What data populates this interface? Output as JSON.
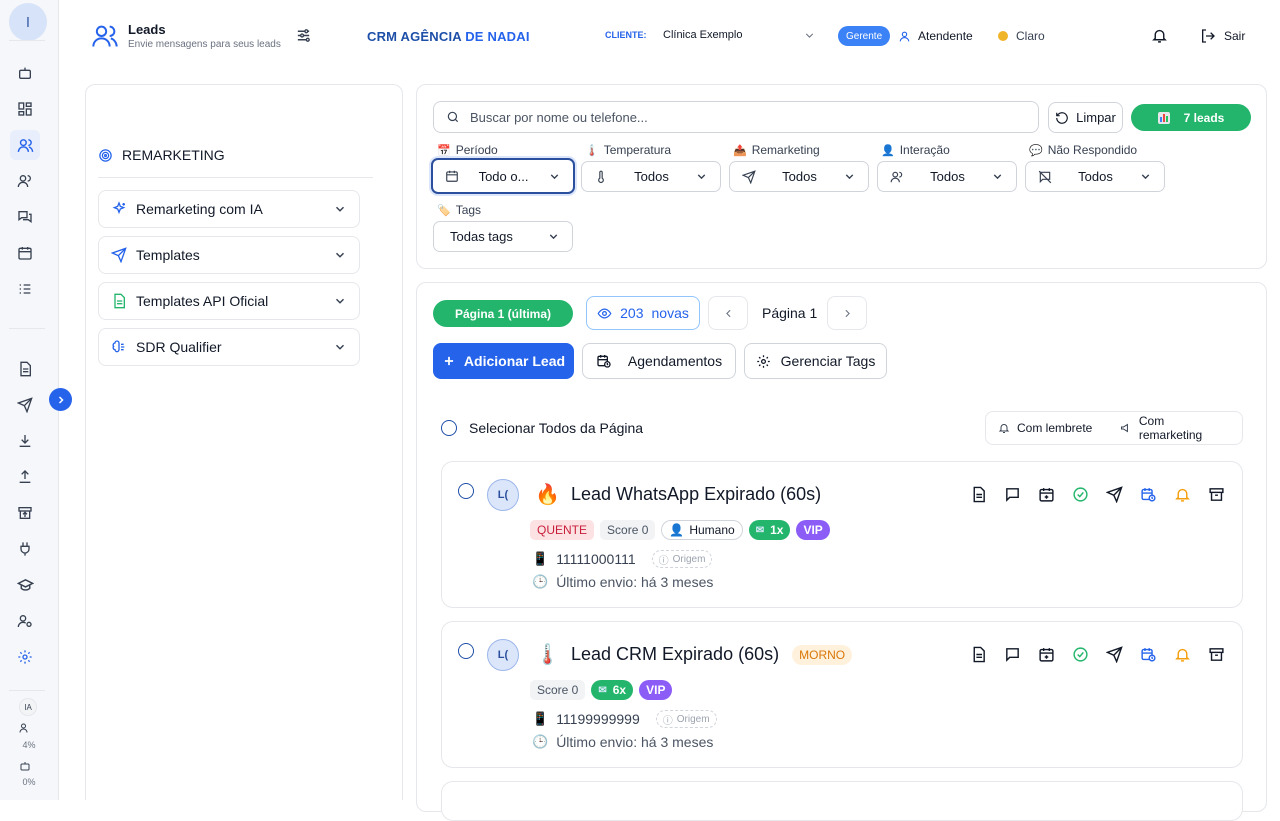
{
  "user": {
    "initial": "I"
  },
  "rail": {
    "stats": [
      {
        "label": "IA"
      },
      {
        "value": "4%"
      },
      {
        "value": "0%"
      }
    ]
  },
  "header": {
    "title": "Leads",
    "subtitle": "Envie mensagens para seus leads",
    "brand_part1": "CRM AGÊNCIA",
    "brand_part2": "DE NADAI",
    "client_label": "CLIENTE:",
    "client_value": "Clínica Exemplo",
    "role_badge": "Gerente",
    "user_name": "Atendente",
    "theme_label": "Claro",
    "logout_label": "Sair"
  },
  "sidebar": {
    "section_title": "REMARKETING",
    "items": [
      {
        "label": "Remarketing com IA"
      },
      {
        "label": "Templates"
      },
      {
        "label": "Templates API Oficial"
      },
      {
        "label": "SDR Qualifier"
      }
    ]
  },
  "filters": {
    "search_placeholder": "Buscar por nome ou telefone...",
    "clear_label": "Limpar",
    "count_label": "7 leads",
    "periodo": {
      "label": "Período",
      "value": "Todo o..."
    },
    "temperatura": {
      "label": "Temperatura",
      "value": "Todos"
    },
    "remarketing": {
      "label": "Remarketing",
      "value": "Todos"
    },
    "interacao": {
      "label": "Interação",
      "value": "Todos"
    },
    "nao_respondido": {
      "label": "Não Respondido",
      "value": "Todos"
    },
    "tags": {
      "label": "Tags",
      "value": "Todas tags"
    }
  },
  "list": {
    "page_pill": "Página 1 (última)",
    "new_count": "203",
    "new_label": "novas",
    "page_label": "Página 1",
    "add_lead": "Adicionar Lead",
    "agendamentos": "Agendamentos",
    "manage_tags": "Gerenciar Tags",
    "select_all": "Selecionar Todos da Página",
    "with_reminder": "Com lembrete",
    "with_remarketing": "Com remarketing"
  },
  "leads": [
    {
      "initials": "L(",
      "emoji": "🔥",
      "name": "Lead WhatsApp Expirado (60s)",
      "temperature": "QUENTE",
      "score": "Score 0",
      "interaction": "Humano",
      "sent_count": "1x",
      "vip": "VIP",
      "phone": "11111000111",
      "origin": "Origem",
      "last_sent": "Último envio: há 3 meses"
    },
    {
      "initials": "L(",
      "emoji": "🌡️",
      "name": "Lead CRM Expirado (60s)",
      "temperature": "MORNO",
      "score": "Score 0",
      "sent_count": "6x",
      "vip": "VIP",
      "phone": "11199999999",
      "origin": "Origem",
      "last_sent": "Último envio: há 3 meses"
    }
  ],
  "colors": {
    "accent": "#2563eb",
    "success": "#22b56b",
    "vip": "#8b5cf6",
    "hot": "#c81e3a",
    "warm": "#d97706"
  }
}
